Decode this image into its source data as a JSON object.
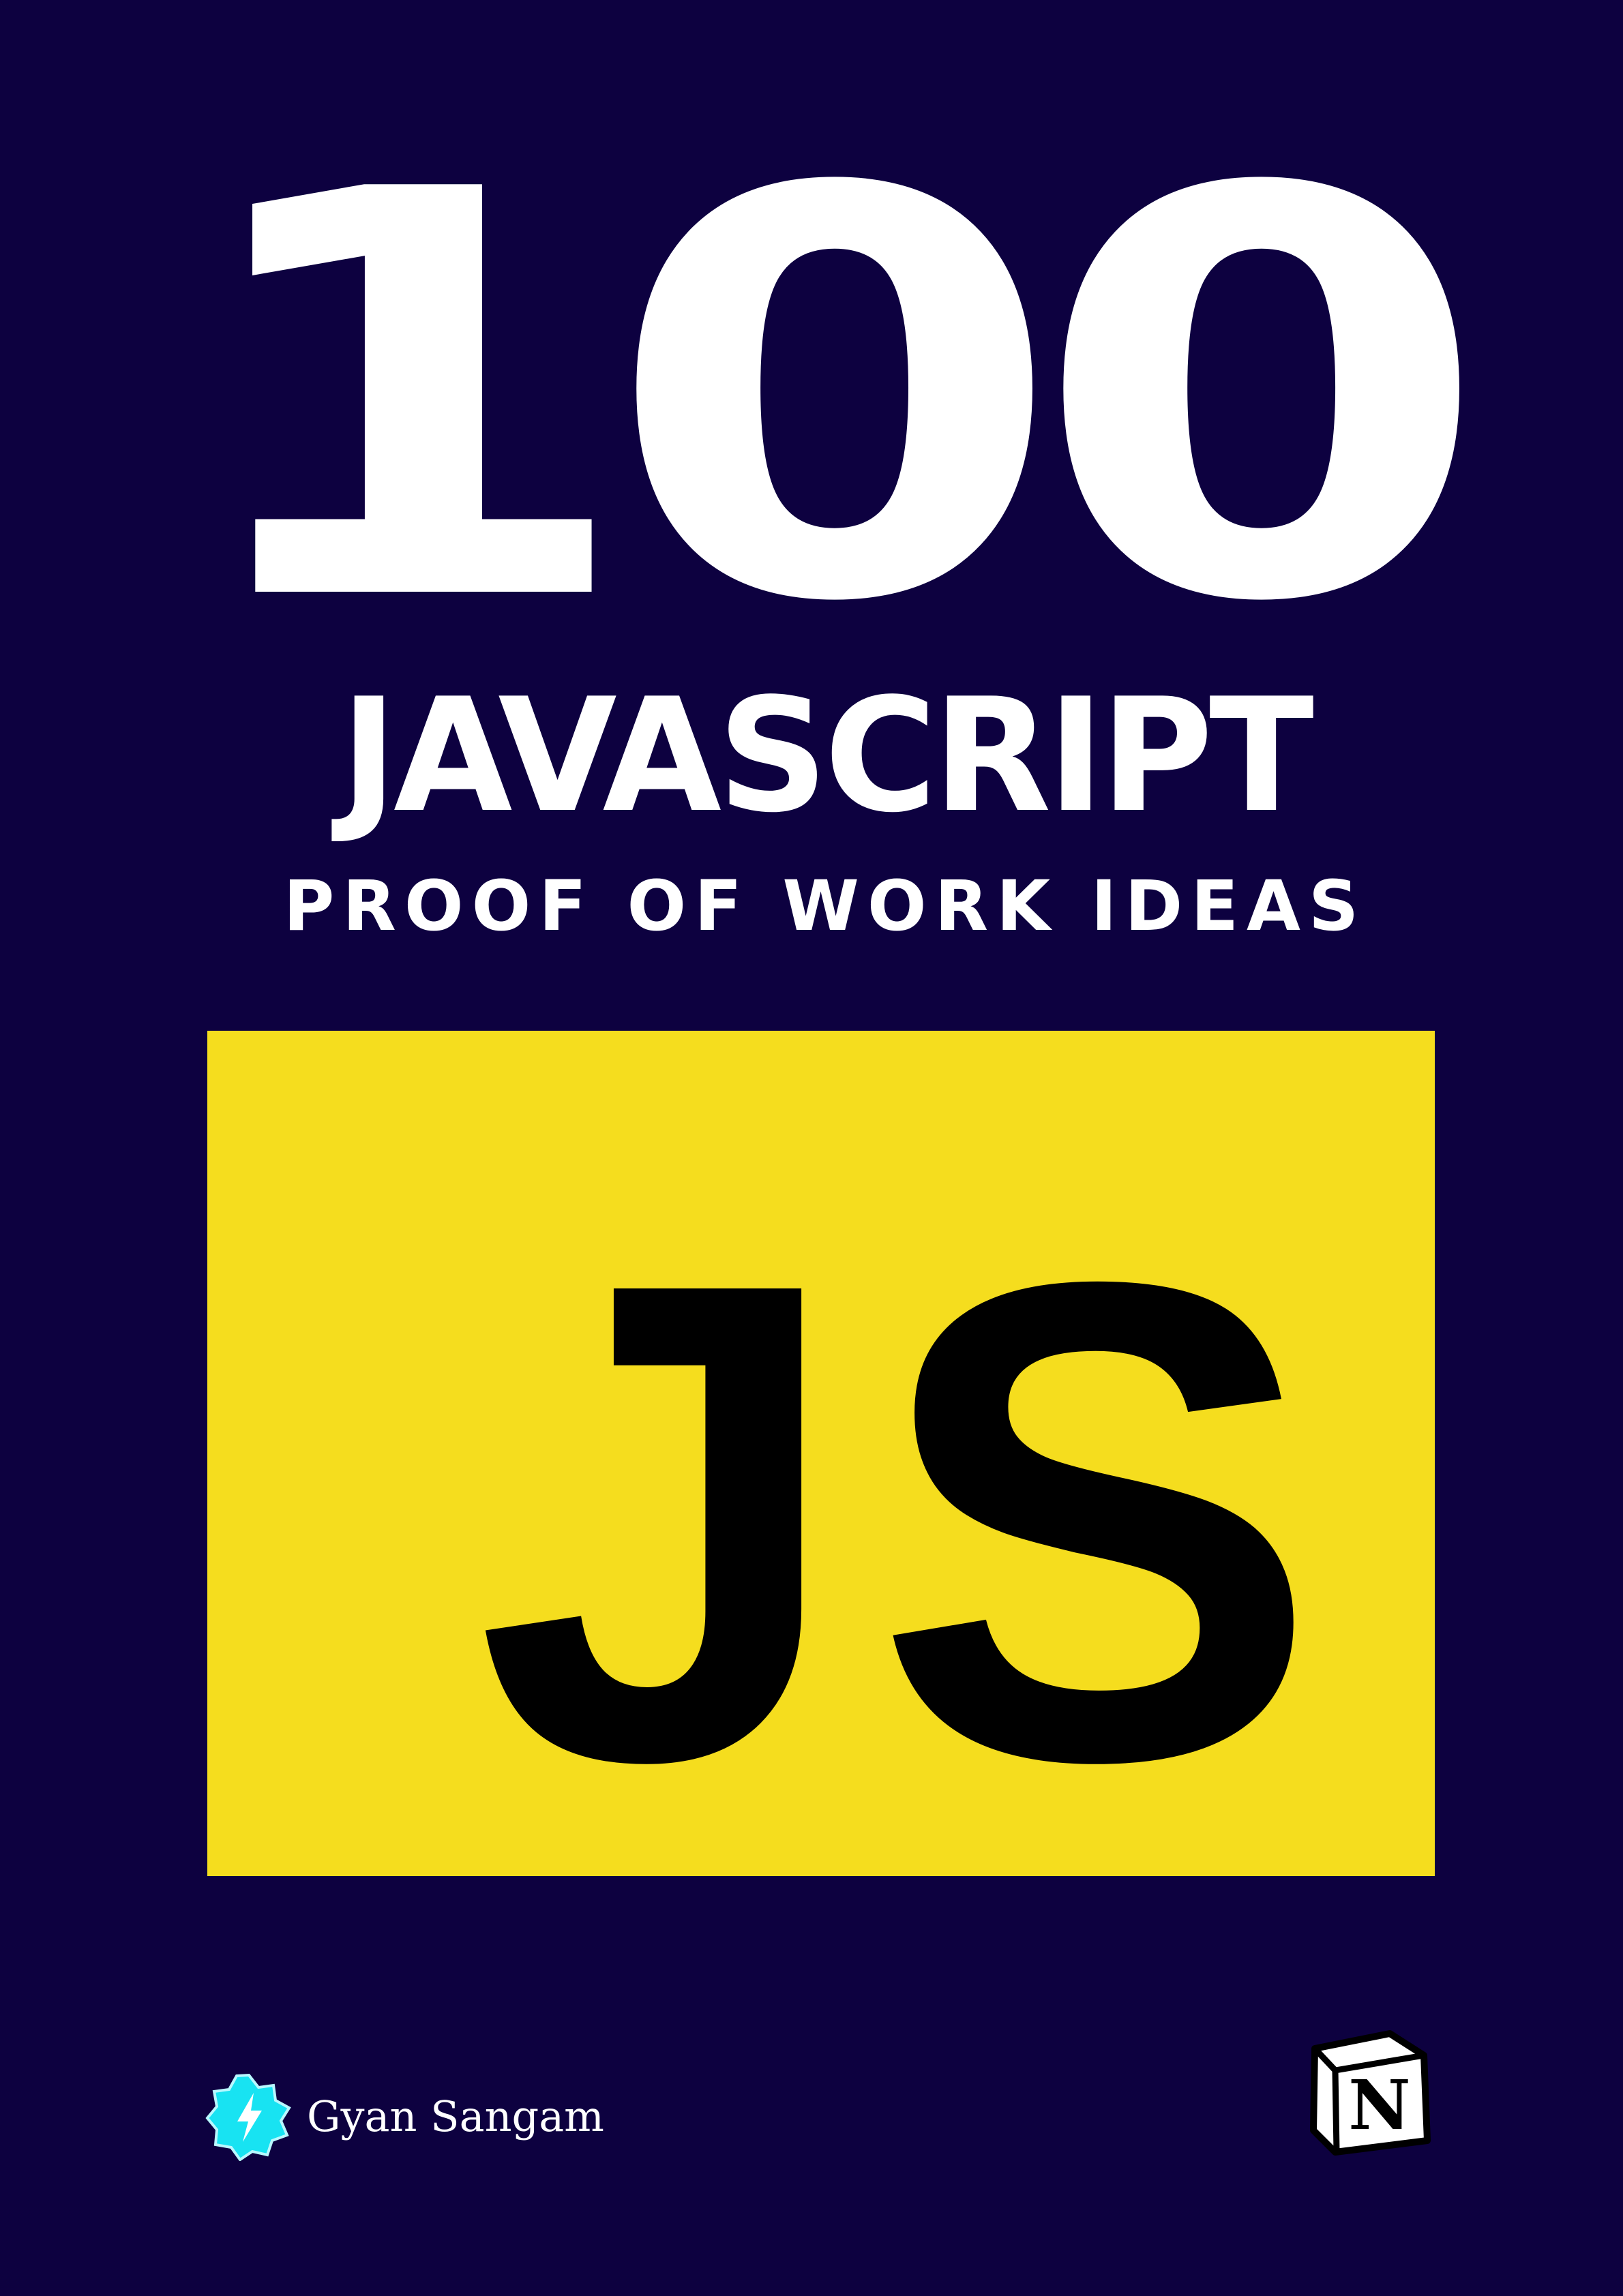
{
  "cover": {
    "number": "100",
    "title": "JAVASCRIPT",
    "subtitle": "PROOF OF WORK IDEAS",
    "logo_text": "JS"
  },
  "brand": {
    "name": "Gyan Sangam",
    "badge_icon": "lightning-badge-icon"
  },
  "notion": {
    "icon": "notion-logo-icon",
    "letter": "N"
  },
  "colors": {
    "background": "#0d0140",
    "js_yellow": "#f5dd1e",
    "text": "#ffffff",
    "badge": "#18e3f2"
  }
}
